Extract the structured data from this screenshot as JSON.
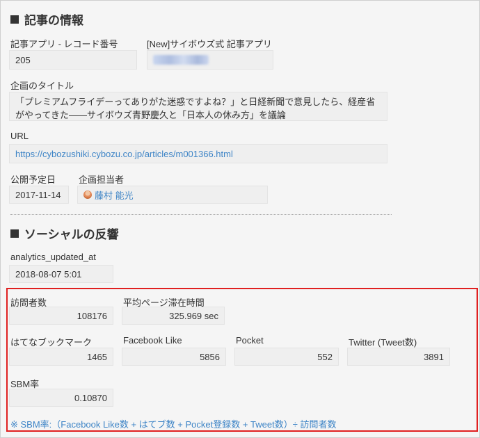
{
  "article_section": {
    "title": "記事の情報",
    "record_number": {
      "label": "記事アプリ - レコード番号",
      "value": "205"
    },
    "new_app": {
      "label": "[New]サイボウズ式 記事アプリ"
    },
    "plan_title": {
      "label": "企画のタイトル",
      "value": "「プレミアムフライデーってありがた迷惑ですよね？」と日経新聞で意見したら、経産省がやってきた――サイボウズ青野慶久と「日本人の休み方」を議論"
    },
    "url": {
      "label": "URL",
      "value": "https://cybozushiki.cybozu.co.jp/articles/m001366.html"
    },
    "publish_date": {
      "label": "公開予定日",
      "value": "2017-11-14"
    },
    "planner": {
      "label": "企画担当者",
      "value": "藤村 能光"
    }
  },
  "social_section": {
    "title": "ソーシャルの反響",
    "analytics_updated_at": {
      "label": "analytics_updated_at",
      "value": "2018-08-07 5:01"
    },
    "visitors": {
      "label": "訪問者数",
      "value": "108176"
    },
    "avg_time": {
      "label": "平均ページ滞在時間",
      "value": "325.969 sec"
    },
    "hatena": {
      "label": "はてなブックマーク",
      "value": "1465"
    },
    "facebook": {
      "label": "Facebook Like",
      "value": "5856"
    },
    "pocket": {
      "label": "Pocket",
      "value": "552"
    },
    "twitter": {
      "label": "Twitter (Tweet数)",
      "value": "3891"
    },
    "sbm_rate": {
      "label": "SBM率",
      "value": "0.10870"
    },
    "formula_note": "※ SBM率:（Facebook Like数 + はてブ数 + Pocket登録数 + Tweet数）÷ 訪問者数"
  },
  "colors": {
    "link": "#3d84c6",
    "highlight_border": "#e02020"
  }
}
